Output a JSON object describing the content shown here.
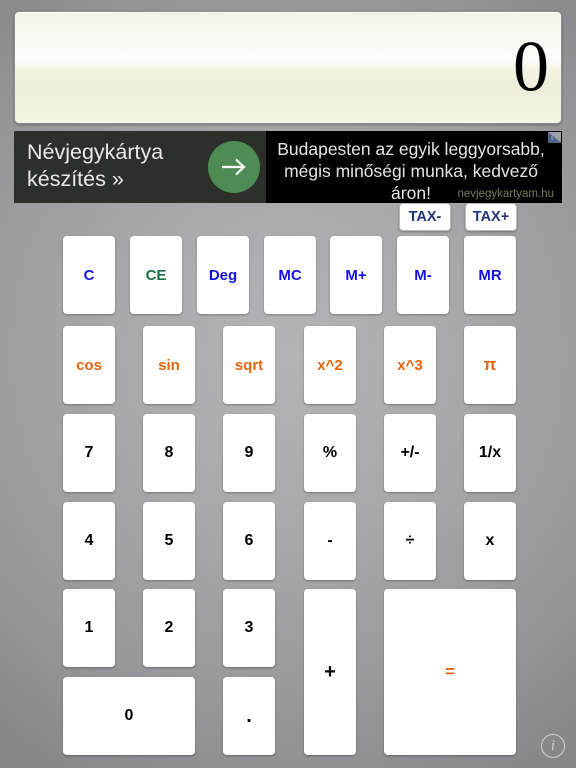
{
  "display": {
    "value": "0"
  },
  "ad": {
    "left_text": "Névjegykártya\nkészítés »",
    "arrow_icon": "arrow-right-icon",
    "headline": "Budapesten az egyik leggyorsabb,\nmégis minőségi munka, kedvező áron!",
    "domain": "nevjegykartyam.hu",
    "adchoices_icon": "adchoices-icon"
  },
  "tax": {
    "minus_label": "TAX-",
    "plus_label": "TAX+"
  },
  "keys": {
    "row1": [
      {
        "label": "C",
        "name": "key-clear",
        "style": "k-blue"
      },
      {
        "label": "CE",
        "name": "key-clear-entry",
        "style": "k-green"
      },
      {
        "label": "Deg",
        "name": "key-degree-mode",
        "style": "k-blue"
      },
      {
        "label": "MC",
        "name": "key-memory-clear",
        "style": "k-blue"
      },
      {
        "label": "M+",
        "name": "key-memory-add",
        "style": "k-blue"
      },
      {
        "label": "M-",
        "name": "key-memory-sub",
        "style": "k-blue"
      },
      {
        "label": "MR",
        "name": "key-memory-recall",
        "style": "k-blue"
      }
    ],
    "row2": [
      {
        "label": "cos",
        "name": "key-cos",
        "style": "k-orange"
      },
      {
        "label": "sin",
        "name": "key-sin",
        "style": "k-orange"
      },
      {
        "label": "sqrt",
        "name": "key-sqrt",
        "style": "k-orange"
      },
      {
        "label": "x^2",
        "name": "key-square",
        "style": "k-orange"
      },
      {
        "label": "x^3",
        "name": "key-cube",
        "style": "k-orange"
      },
      {
        "label": "π",
        "name": "key-pi",
        "style": "k-pi"
      }
    ],
    "row3": [
      {
        "label": "7",
        "name": "key-7",
        "style": "k-black"
      },
      {
        "label": "8",
        "name": "key-8",
        "style": "k-black"
      },
      {
        "label": "9",
        "name": "key-9",
        "style": "k-black"
      },
      {
        "label": "%",
        "name": "key-percent",
        "style": "k-black"
      },
      {
        "label": "+/-",
        "name": "key-sign",
        "style": "k-black"
      },
      {
        "label": "1/x",
        "name": "key-reciprocal",
        "style": "k-black"
      }
    ],
    "row4": [
      {
        "label": "4",
        "name": "key-4",
        "style": "k-black"
      },
      {
        "label": "5",
        "name": "key-5",
        "style": "k-black"
      },
      {
        "label": "6",
        "name": "key-6",
        "style": "k-black"
      },
      {
        "label": "-",
        "name": "key-subtract",
        "style": "k-black"
      },
      {
        "label": "÷",
        "name": "key-divide",
        "style": "k-black"
      },
      {
        "label": "x",
        "name": "key-multiply",
        "style": "k-black"
      }
    ],
    "row5": [
      {
        "label": "1",
        "name": "key-1",
        "style": "k-black"
      },
      {
        "label": "2",
        "name": "key-2",
        "style": "k-black"
      },
      {
        "label": "3",
        "name": "key-3",
        "style": "k-black"
      }
    ],
    "row6": [
      {
        "label": "0",
        "name": "key-0",
        "style": "k-black"
      },
      {
        "label": ".",
        "name": "key-decimal",
        "style": "k-dot"
      }
    ],
    "plus": {
      "label": "+",
      "name": "key-add",
      "style": "k-plus"
    },
    "equals": {
      "label": "=",
      "name": "key-equals",
      "style": "k-eq"
    }
  },
  "info": {
    "label": "i",
    "icon": "info-icon"
  },
  "colors": {
    "accent_orange": "#e8650e",
    "accent_blue": "#1314e0",
    "accent_green": "#17713f",
    "tax_navy": "#22357a",
    "display_bg": "#f2f3e3",
    "background": "#97979b"
  }
}
